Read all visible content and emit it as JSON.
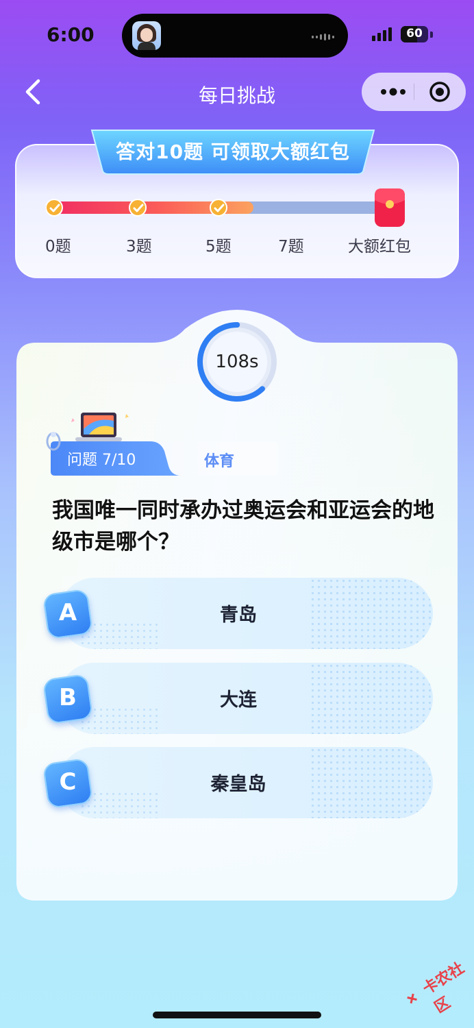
{
  "status_bar": {
    "time": "6:00",
    "battery": "60",
    "battery_level": 0.6
  },
  "nav": {
    "title": "每日挑战",
    "back_icon": "chevron-left-icon",
    "more_icon": "more-dots-icon",
    "close_icon": "target-circle-icon"
  },
  "reward": {
    "banner": "答对10题  可领取大额红包",
    "progress_fraction": 0.62,
    "milestones": [
      {
        "label": "0题",
        "done": true
      },
      {
        "label": "3题",
        "done": true
      },
      {
        "label": "5题",
        "done": true
      },
      {
        "label": "7题",
        "done": false
      },
      {
        "label": "大额红包",
        "done": false
      }
    ]
  },
  "timer": {
    "text": "108s",
    "remaining_fraction": 0.62
  },
  "question": {
    "number_label": "问题 7/10",
    "category": "体育",
    "text": "我国唯一同时承办过奥运会和亚运会的地级市是哪个？",
    "options": [
      {
        "letter": "A",
        "text": "青岛"
      },
      {
        "letter": "B",
        "text": "大连"
      },
      {
        "letter": "C",
        "text": "秦皇岛"
      }
    ]
  },
  "watermark": "卡农社区",
  "colors": {
    "accent": "#2f7ef3",
    "progress": "#f02a63",
    "track": "#9ab1e1"
  }
}
